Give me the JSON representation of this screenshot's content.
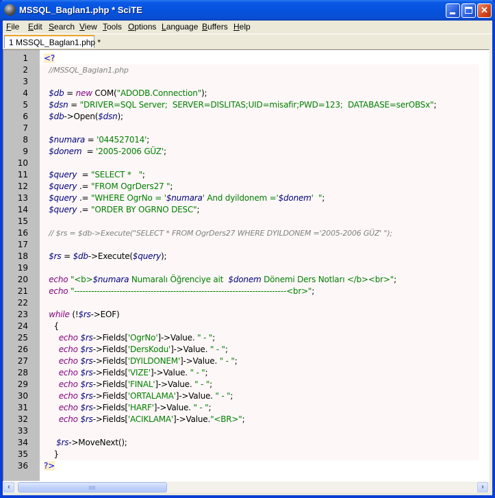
{
  "window": {
    "title": "MSSQL_Baglan1.php * SciTE",
    "buttons": {
      "minimize": "minimize",
      "maximize": "maximize",
      "close": "×"
    }
  },
  "menu": [
    {
      "label": "File",
      "accel": "F"
    },
    {
      "label": "Edit",
      "accel": "E"
    },
    {
      "label": "Search",
      "accel": "S"
    },
    {
      "label": "View",
      "accel": "V"
    },
    {
      "label": "Tools",
      "accel": "T"
    },
    {
      "label": "Options",
      "accel": "O"
    },
    {
      "label": "Language",
      "accel": "L"
    },
    {
      "label": "Buffers",
      "accel": "B"
    },
    {
      "label": "Help",
      "accel": "H"
    }
  ],
  "tabs": [
    {
      "label": "1 MSSQL_Baglan1.php *",
      "active": true
    }
  ],
  "colors": {
    "tag": "#0000ff",
    "comment": "#808080",
    "variable": "#00007f",
    "keyword": "#7f007f",
    "string": "#008000",
    "gutter": "#c0c0c0",
    "code_bg": "#fdf7f7"
  },
  "lines": [
    {
      "n": "1",
      "bg": false,
      "tokens": [
        [
          "tag",
          "<?"
        ]
      ]
    },
    {
      "n": "2",
      "bg": true,
      "tokens": [
        [
          "def",
          "  "
        ],
        [
          "cm",
          "//MSSQL_Baglan1.php"
        ]
      ]
    },
    {
      "n": "3",
      "bg": true,
      "tokens": []
    },
    {
      "n": "4",
      "bg": true,
      "tokens": [
        [
          "def",
          "  "
        ],
        [
          "var",
          "$db"
        ],
        [
          "def",
          " = "
        ],
        [
          "kw",
          "new"
        ],
        [
          "def",
          " COM("
        ],
        [
          "str",
          "\"ADODB.Connection\""
        ],
        [
          "def",
          ");"
        ]
      ]
    },
    {
      "n": "5",
      "bg": true,
      "tokens": [
        [
          "def",
          "  "
        ],
        [
          "var",
          "$dsn"
        ],
        [
          "def",
          " = "
        ],
        [
          "str",
          "\"DRIVER=SQL Server;  SERVER=DISLITAS;UID=misafir;PWD=123;  DATABASE=serOBSx\""
        ],
        [
          "def",
          ";"
        ]
      ]
    },
    {
      "n": "6",
      "bg": true,
      "tokens": [
        [
          "def",
          "  "
        ],
        [
          "var",
          "$db"
        ],
        [
          "def",
          "->Open("
        ],
        [
          "var",
          "$dsn"
        ],
        [
          "def",
          ");"
        ]
      ]
    },
    {
      "n": "7",
      "bg": true,
      "tokens": []
    },
    {
      "n": "8",
      "bg": true,
      "tokens": [
        [
          "def",
          "  "
        ],
        [
          "var",
          "$numara"
        ],
        [
          "def",
          " = "
        ],
        [
          "str",
          "'044527014'"
        ],
        [
          "def",
          ";"
        ]
      ]
    },
    {
      "n": "9",
      "bg": true,
      "tokens": [
        [
          "def",
          "  "
        ],
        [
          "var",
          "$donem"
        ],
        [
          "def",
          "  = "
        ],
        [
          "str",
          "'2005-2006 GÜZ'"
        ],
        [
          "def",
          ";"
        ]
      ]
    },
    {
      "n": "10",
      "bg": true,
      "tokens": []
    },
    {
      "n": "11",
      "bg": true,
      "tokens": [
        [
          "def",
          "  "
        ],
        [
          "var",
          "$query"
        ],
        [
          "def",
          "  = "
        ],
        [
          "str",
          "\"SELECT *   \""
        ],
        [
          "def",
          ";"
        ]
      ]
    },
    {
      "n": "12",
      "bg": true,
      "tokens": [
        [
          "def",
          "  "
        ],
        [
          "var",
          "$query"
        ],
        [
          "def",
          " .= "
        ],
        [
          "str",
          "\"FROM OgrDers27 \""
        ],
        [
          "def",
          ";"
        ]
      ]
    },
    {
      "n": "13",
      "bg": true,
      "tokens": [
        [
          "def",
          "  "
        ],
        [
          "var",
          "$query"
        ],
        [
          "def",
          " .= "
        ],
        [
          "str",
          "\"WHERE OgrNo = '"
        ],
        [
          "var",
          "$numara"
        ],
        [
          "str",
          "' And dyildonem ='"
        ],
        [
          "var",
          "$donem"
        ],
        [
          "str",
          "'  \""
        ],
        [
          "def",
          ";"
        ]
      ]
    },
    {
      "n": "14",
      "bg": true,
      "tokens": [
        [
          "def",
          "  "
        ],
        [
          "var",
          "$query"
        ],
        [
          "def",
          " .= "
        ],
        [
          "str",
          "\"ORDER BY OGRNO DESC\""
        ],
        [
          "def",
          ";"
        ]
      ]
    },
    {
      "n": "15",
      "bg": true,
      "tokens": []
    },
    {
      "n": "16",
      "bg": true,
      "tokens": [
        [
          "def",
          "  "
        ],
        [
          "cm",
          "// $rs = $db->Execute(\"SELECT * FROM OgrDers27 WHERE DYILDONEM ='2005-2006 GÜZ' \");"
        ]
      ]
    },
    {
      "n": "17",
      "bg": true,
      "tokens": []
    },
    {
      "n": "18",
      "bg": true,
      "tokens": [
        [
          "def",
          "  "
        ],
        [
          "var",
          "$rs"
        ],
        [
          "def",
          " = "
        ],
        [
          "var",
          "$db"
        ],
        [
          "def",
          "->Execute("
        ],
        [
          "var",
          "$query"
        ],
        [
          "def",
          ");"
        ]
      ]
    },
    {
      "n": "19",
      "bg": true,
      "tokens": []
    },
    {
      "n": "20",
      "bg": true,
      "tokens": [
        [
          "def",
          "  "
        ],
        [
          "kw",
          "echo"
        ],
        [
          "def",
          " "
        ],
        [
          "str",
          "\"<b>"
        ],
        [
          "var",
          "$numara"
        ],
        [
          "str",
          " Numaralı Öğrenciye ait  "
        ],
        [
          "var",
          "$donem"
        ],
        [
          "str",
          " Dönemi Ders Notları </b><br>\""
        ],
        [
          "def",
          ";"
        ]
      ]
    },
    {
      "n": "21",
      "bg": true,
      "tokens": [
        [
          "def",
          "  "
        ],
        [
          "kw",
          "echo"
        ],
        [
          "def",
          " "
        ],
        [
          "str",
          "\"---------------------------------------------------------------------------<br>\""
        ],
        [
          "def",
          ";"
        ]
      ]
    },
    {
      "n": "22",
      "bg": true,
      "tokens": []
    },
    {
      "n": "23",
      "bg": true,
      "tokens": [
        [
          "def",
          "  "
        ],
        [
          "kw",
          "while"
        ],
        [
          "def",
          " (!"
        ],
        [
          "var",
          "$rs"
        ],
        [
          "def",
          "->EOF)"
        ]
      ]
    },
    {
      "n": "24",
      "bg": true,
      "tokens": [
        [
          "def",
          "    {"
        ]
      ]
    },
    {
      "n": "25",
      "bg": true,
      "tokens": [
        [
          "def",
          "      "
        ],
        [
          "kw",
          "echo"
        ],
        [
          "def",
          " "
        ],
        [
          "var",
          "$rs"
        ],
        [
          "def",
          "->Fields["
        ],
        [
          "str",
          "'OgrNo'"
        ],
        [
          "def",
          "]->Value. "
        ],
        [
          "str",
          "\" - \""
        ],
        [
          "def",
          ";"
        ]
      ]
    },
    {
      "n": "26",
      "bg": true,
      "tokens": [
        [
          "def",
          "      "
        ],
        [
          "kw",
          "echo"
        ],
        [
          "def",
          " "
        ],
        [
          "var",
          "$rs"
        ],
        [
          "def",
          "->Fields["
        ],
        [
          "str",
          "'DersKodu'"
        ],
        [
          "def",
          "]->Value. "
        ],
        [
          "str",
          "\" - \""
        ],
        [
          "def",
          ";"
        ]
      ]
    },
    {
      "n": "27",
      "bg": true,
      "tokens": [
        [
          "def",
          "      "
        ],
        [
          "kw",
          "echo"
        ],
        [
          "def",
          " "
        ],
        [
          "var",
          "$rs"
        ],
        [
          "def",
          "->Fields["
        ],
        [
          "str",
          "'DYILDONEM'"
        ],
        [
          "def",
          "]->Value. "
        ],
        [
          "str",
          "\" - \""
        ],
        [
          "def",
          ";"
        ]
      ]
    },
    {
      "n": "28",
      "bg": true,
      "tokens": [
        [
          "def",
          "      "
        ],
        [
          "kw",
          "echo"
        ],
        [
          "def",
          " "
        ],
        [
          "var",
          "$rs"
        ],
        [
          "def",
          "->Fields["
        ],
        [
          "str",
          "'VIZE'"
        ],
        [
          "def",
          "]->Value. "
        ],
        [
          "str",
          "\" - \""
        ],
        [
          "def",
          ";"
        ]
      ]
    },
    {
      "n": "29",
      "bg": true,
      "tokens": [
        [
          "def",
          "      "
        ],
        [
          "kw",
          "echo"
        ],
        [
          "def",
          " "
        ],
        [
          "var",
          "$rs"
        ],
        [
          "def",
          "->Fields["
        ],
        [
          "str",
          "'FINAL'"
        ],
        [
          "def",
          "]->Value. "
        ],
        [
          "str",
          "\" - \""
        ],
        [
          "def",
          ";"
        ]
      ]
    },
    {
      "n": "30",
      "bg": true,
      "tokens": [
        [
          "def",
          "      "
        ],
        [
          "kw",
          "echo"
        ],
        [
          "def",
          " "
        ],
        [
          "var",
          "$rs"
        ],
        [
          "def",
          "->Fields["
        ],
        [
          "str",
          "'ORTALAMA'"
        ],
        [
          "def",
          "]->Value. "
        ],
        [
          "str",
          "\" - \""
        ],
        [
          "def",
          ";"
        ]
      ]
    },
    {
      "n": "31",
      "bg": true,
      "tokens": [
        [
          "def",
          "      "
        ],
        [
          "kw",
          "echo"
        ],
        [
          "def",
          " "
        ],
        [
          "var",
          "$rs"
        ],
        [
          "def",
          "->Fields["
        ],
        [
          "str",
          "'HARF'"
        ],
        [
          "def",
          "]->Value. "
        ],
        [
          "str",
          "\" - \""
        ],
        [
          "def",
          ";"
        ]
      ]
    },
    {
      "n": "32",
      "bg": true,
      "tokens": [
        [
          "def",
          "      "
        ],
        [
          "kw",
          "echo"
        ],
        [
          "def",
          " "
        ],
        [
          "var",
          "$rs"
        ],
        [
          "def",
          "->Fields["
        ],
        [
          "str",
          "'ACIKLAMA'"
        ],
        [
          "def",
          "]->Value."
        ],
        [
          "str",
          "\"<BR>\""
        ],
        [
          "def",
          ";"
        ]
      ]
    },
    {
      "n": "33",
      "bg": true,
      "tokens": []
    },
    {
      "n": "34",
      "bg": true,
      "tokens": [
        [
          "def",
          "     "
        ],
        [
          "var",
          "$rs"
        ],
        [
          "def",
          "->MoveNext();"
        ]
      ]
    },
    {
      "n": "35",
      "bg": true,
      "tokens": [
        [
          "def",
          "    }"
        ]
      ]
    },
    {
      "n": "36",
      "bg": false,
      "tokens": [
        [
          "tag",
          "?>"
        ]
      ]
    }
  ],
  "scrollbar": {
    "left_arrow": "‹",
    "right_arrow": "›"
  }
}
